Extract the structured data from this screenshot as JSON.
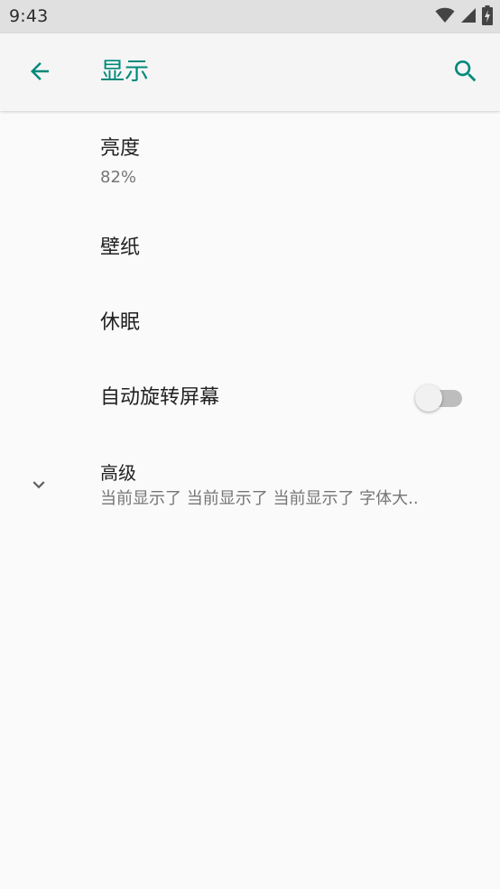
{
  "status_bar": {
    "time": "9:43",
    "icons": [
      "wifi-icon",
      "cell-signal-icon",
      "battery-charging-icon"
    ]
  },
  "app_bar": {
    "title": "显示",
    "back_icon": "arrow-back-icon",
    "search_icon": "search-icon"
  },
  "colors": {
    "accent": "#00897b",
    "status_bar": "#e0e0e0",
    "app_bar": "#f5f5f5",
    "background": "#fafafa"
  },
  "settings": {
    "brightness": {
      "title": "亮度",
      "summary": "82%"
    },
    "wallpaper": {
      "title": "壁纸"
    },
    "sleep": {
      "title": "休眠"
    },
    "auto_rotate": {
      "title": "自动旋转屏幕",
      "enabled": false
    },
    "advanced": {
      "title": "高级",
      "summary": "当前显示了 当前显示了 当前显示了 字体大..",
      "icon": "chevron-down-icon"
    }
  }
}
